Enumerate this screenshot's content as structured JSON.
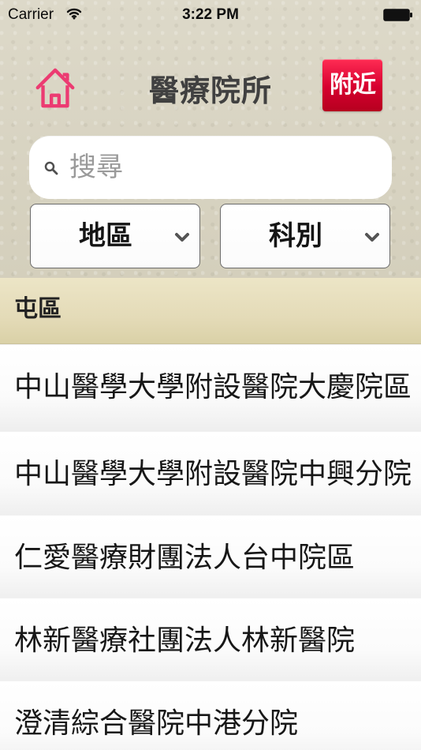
{
  "status_bar": {
    "carrier": "Carrier",
    "time": "3:22 PM",
    "icons": {
      "wifi": "wifi-icon",
      "battery": "battery-icon"
    }
  },
  "header": {
    "title": "醫療院所",
    "home_icon": "home-icon",
    "nearby_label": "附近"
  },
  "search": {
    "placeholder": "搜尋",
    "value": ""
  },
  "filters": {
    "district_label": "地區",
    "specialty_label": "科別",
    "dropdown_icon": "chevron-down-icon"
  },
  "section": {
    "title": "屯區"
  },
  "hospitals": [
    {
      "name": "中山醫學大學附設醫院大慶院區"
    },
    {
      "name": "中山醫學大學附設醫院中興分院"
    },
    {
      "name": "仁愛醫療財團法人台中院區"
    },
    {
      "name": "林新醫療社團法人林新醫院"
    },
    {
      "name": "澄清綜合醫院中港分院"
    }
  ],
  "colors": {
    "accent_pink": "#e83d74",
    "nearby_red": "#d6002f",
    "section_tan": "#e4dbb8"
  }
}
